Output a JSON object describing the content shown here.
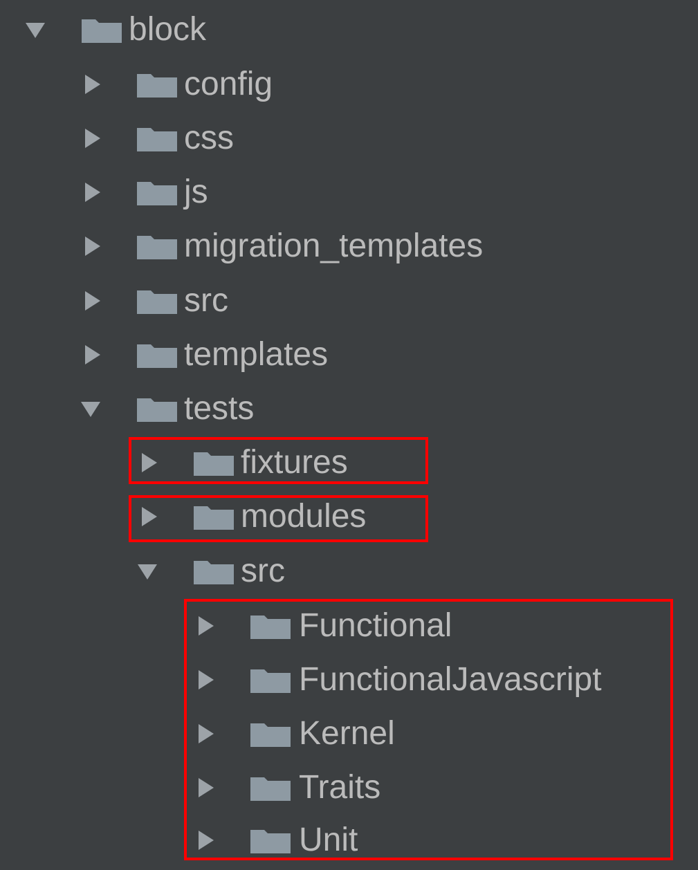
{
  "tree": {
    "root": {
      "label": "block",
      "expanded": true,
      "arrow_icon": "chevron-down-icon",
      "folder_icon": "folder-icon"
    },
    "children": [
      {
        "label": "config",
        "expanded": false
      },
      {
        "label": "css",
        "expanded": false
      },
      {
        "label": "js",
        "expanded": false
      },
      {
        "label": "migration_templates",
        "expanded": false
      },
      {
        "label": "src",
        "expanded": false
      },
      {
        "label": "templates",
        "expanded": false
      },
      {
        "label": "tests",
        "expanded": true
      }
    ],
    "tests_children": [
      {
        "label": "fixtures",
        "expanded": false,
        "highlighted": true
      },
      {
        "label": "modules",
        "expanded": false,
        "highlighted": true
      },
      {
        "label": "src",
        "expanded": true,
        "highlighted": false
      }
    ],
    "tests_src_children": [
      {
        "label": "Functional",
        "expanded": false
      },
      {
        "label": "FunctionalJavascript",
        "expanded": false
      },
      {
        "label": "Kernel",
        "expanded": false
      },
      {
        "label": "Traits",
        "expanded": false
      },
      {
        "label": "Unit",
        "expanded": false
      }
    ]
  },
  "colors": {
    "background": "#3c3f41",
    "text": "#bbbbbb",
    "folder": "#8e9aa3",
    "arrow": "#9da3a8",
    "highlight_box": "#ff0000"
  }
}
